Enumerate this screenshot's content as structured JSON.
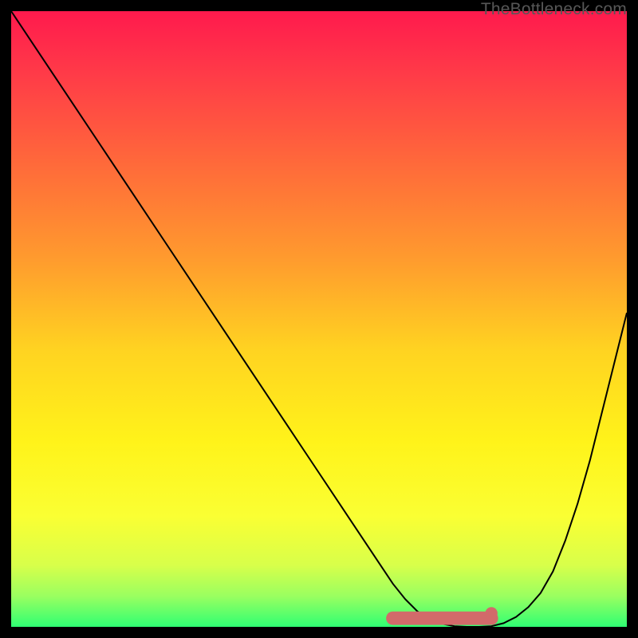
{
  "watermark": "TheBottleneck.com",
  "chart_data": {
    "type": "line",
    "title": "",
    "xlabel": "",
    "ylabel": "",
    "xlim": [
      0,
      100
    ],
    "ylim": [
      0,
      100
    ],
    "grid": false,
    "legend": false,
    "background_gradient": {
      "stops": [
        {
          "offset": 0.0,
          "color": "#ff1a4d"
        },
        {
          "offset": 0.1,
          "color": "#ff3a48"
        },
        {
          "offset": 0.25,
          "color": "#ff6a3a"
        },
        {
          "offset": 0.4,
          "color": "#ff9a2e"
        },
        {
          "offset": 0.55,
          "color": "#ffd321"
        },
        {
          "offset": 0.7,
          "color": "#fff31a"
        },
        {
          "offset": 0.82,
          "color": "#faff33"
        },
        {
          "offset": 0.9,
          "color": "#d8ff4a"
        },
        {
          "offset": 0.95,
          "color": "#9aff60"
        },
        {
          "offset": 1.0,
          "color": "#2fff73"
        }
      ]
    },
    "curve": {
      "x": [
        0,
        5,
        10,
        15,
        20,
        25,
        30,
        35,
        40,
        45,
        50,
        55,
        60,
        62,
        64,
        66,
        68,
        70,
        72,
        74,
        76,
        78,
        80,
        82,
        84,
        86,
        88,
        90,
        92,
        94,
        96,
        98,
        100
      ],
      "y": [
        100,
        92.5,
        85,
        77.5,
        70,
        62.5,
        55,
        47.5,
        40,
        32.5,
        25,
        17.5,
        10,
        7,
        4.5,
        2.5,
        1.2,
        0.5,
        0.1,
        0,
        0,
        0.1,
        0.6,
        1.6,
        3.2,
        5.5,
        9,
        14,
        20,
        27,
        35,
        43,
        51
      ]
    },
    "flat_marker": {
      "color": "#d26a6a",
      "x_start": 62,
      "x_end": 78,
      "y": 1.4,
      "thickness": 2.2,
      "end_dot_x": 78,
      "end_dot_y": 2.2,
      "end_dot_r": 1.0
    }
  }
}
